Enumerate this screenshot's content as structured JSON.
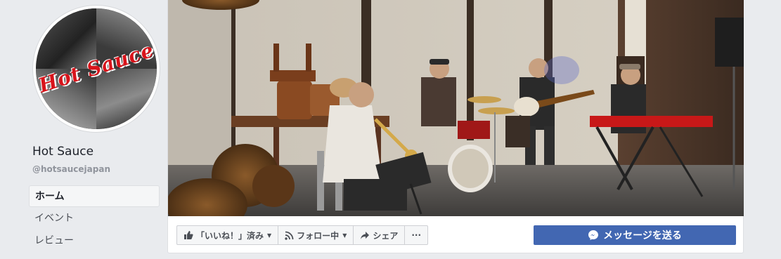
{
  "page": {
    "name": "Hot Sauce",
    "handle": "@hotsaucejapan",
    "logo_text": "Hot Sauce"
  },
  "nav": {
    "items": [
      {
        "label": "ホーム",
        "active": true
      },
      {
        "label": "イベント",
        "active": false
      },
      {
        "label": "レビュー",
        "active": false
      }
    ]
  },
  "actions": {
    "like_label": "「いいね！」済み",
    "follow_label": "フォロー中",
    "share_label": "シェア",
    "more_label": "···",
    "message_label": "メッセージを送る"
  },
  "colors": {
    "primary": "#4267b2",
    "background": "#e9ebee",
    "text_secondary": "#90949c",
    "logo_red": "#d8141b"
  },
  "icons": {
    "like": "thumbs-up-icon",
    "follow": "rss-icon",
    "share": "share-arrow-icon",
    "more": "more-dots-icon",
    "message": "messenger-icon"
  }
}
